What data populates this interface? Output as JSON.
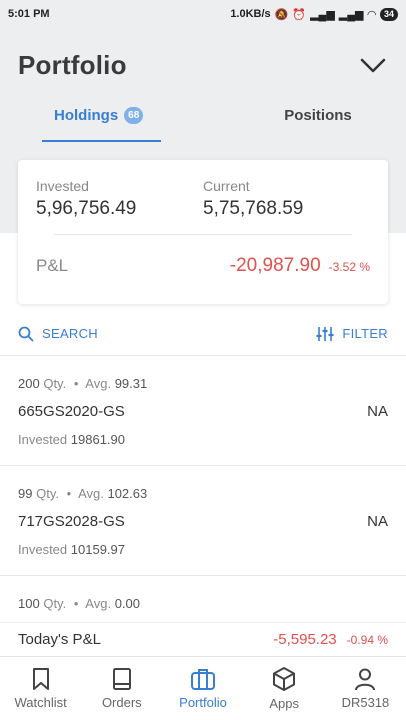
{
  "status": {
    "time": "5:01 PM",
    "speed": "1.0KB/s",
    "battery": "34"
  },
  "header": {
    "title": "Portfolio"
  },
  "tabs": [
    {
      "label": "Holdings",
      "count": "68"
    },
    {
      "label": "Positions"
    }
  ],
  "summary": {
    "invested_label": "Invested",
    "invested_value": "5,96,756.49",
    "current_label": "Current",
    "current_value": "5,75,768.59",
    "pnl_label": "P&L",
    "pnl_value": "-20,987.90",
    "pnl_pct": "-3.52 %"
  },
  "toolbar": {
    "search_label": "SEARCH",
    "filter_label": "FILTER"
  },
  "holdings": [
    {
      "qty": "200",
      "qty_label": "Qty.",
      "avg_label": "Avg.",
      "avg": "99.31",
      "symbol": "665GS2020-GS",
      "status": "NA",
      "invested_label": "Invested",
      "invested": "19861.90"
    },
    {
      "qty": "99",
      "qty_label": "Qty.",
      "avg_label": "Avg.",
      "avg": "102.63",
      "symbol": "717GS2028-GS",
      "status": "NA",
      "invested_label": "Invested",
      "invested": "10159.97"
    },
    {
      "qty": "100",
      "qty_label": "Qty.",
      "avg_label": "Avg.",
      "avg": "0.00"
    }
  ],
  "today": {
    "label": "Today's P&L",
    "value": "-5,595.23",
    "pct": "-0.94 %"
  },
  "nav": [
    {
      "label": "Watchlist"
    },
    {
      "label": "Orders"
    },
    {
      "label": "Portfolio"
    },
    {
      "label": "Apps"
    },
    {
      "label": "DR5318"
    }
  ],
  "colors": {
    "accent": "#387ed1",
    "loss": "#df514c",
    "header_bg": "#eceef0"
  }
}
